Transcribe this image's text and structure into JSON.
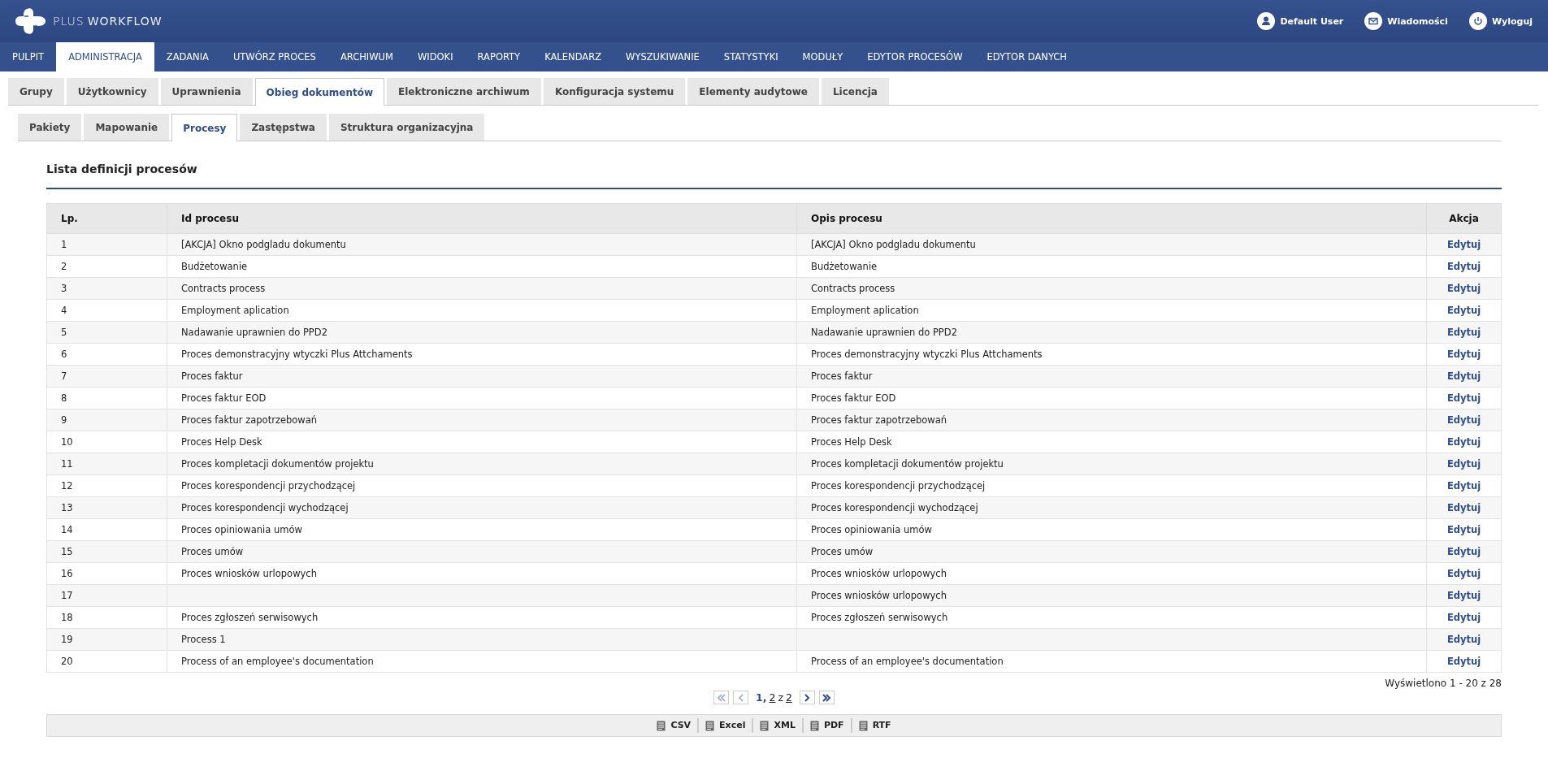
{
  "header": {
    "logo_plus": "PLUS",
    "logo_workflow": "WORKFLOW",
    "user_links": [
      {
        "kind": "user",
        "label": "Default User"
      },
      {
        "kind": "mail",
        "label": "Wiadomości"
      },
      {
        "kind": "power",
        "label": "Wyloguj"
      }
    ]
  },
  "main_menu": [
    {
      "label": "PULPIT",
      "selected": false
    },
    {
      "label": "ADMINISTRACJA",
      "selected": true
    },
    {
      "label": "ZADANIA",
      "selected": false
    },
    {
      "label": "UTWÓRZ PROCES",
      "selected": false
    },
    {
      "label": "ARCHIWUM",
      "selected": false
    },
    {
      "label": "WIDOKI",
      "selected": false
    },
    {
      "label": "RAPORTY",
      "selected": false
    },
    {
      "label": "KALENDARZ",
      "selected": false
    },
    {
      "label": "WYSZUKIWANIE",
      "selected": false
    },
    {
      "label": "STATYSTYKI",
      "selected": false
    },
    {
      "label": "MODUŁY",
      "selected": false
    },
    {
      "label": "EDYTOR PROCESÓW",
      "selected": false
    },
    {
      "label": "EDYTOR DANYCH",
      "selected": false
    }
  ],
  "tabs": [
    {
      "label": "Grupy",
      "selected": false
    },
    {
      "label": "Użytkownicy",
      "selected": false
    },
    {
      "label": "Uprawnienia",
      "selected": false
    },
    {
      "label": "Obieg dokumentów",
      "selected": true
    },
    {
      "label": "Elektroniczne archiwum",
      "selected": false
    },
    {
      "label": "Konfiguracja systemu",
      "selected": false
    },
    {
      "label": "Elementy audytowe",
      "selected": false
    },
    {
      "label": "Licencja",
      "selected": false
    }
  ],
  "subtabs": [
    {
      "label": "Pakiety",
      "selected": false
    },
    {
      "label": "Mapowanie",
      "selected": false
    },
    {
      "label": "Procesy",
      "selected": true
    },
    {
      "label": "Zastępstwa",
      "selected": false
    },
    {
      "label": "Struktura organizacyjna",
      "selected": false
    }
  ],
  "section_title": "Lista definicji procesów",
  "table": {
    "columns": [
      "Lp.",
      "Id procesu",
      "Opis procesu",
      "Akcja"
    ],
    "rows": [
      {
        "lp": "1",
        "id": "[AKCJA] Okno podgladu dokumentu",
        "opis": "[AKCJA] Okno podgladu dokumentu",
        "action": "Edytuj"
      },
      {
        "lp": "2",
        "id": "Budżetowanie",
        "opis": "Budżetowanie",
        "action": "Edytuj"
      },
      {
        "lp": "3",
        "id": "Contracts process",
        "opis": "Contracts process",
        "action": "Edytuj"
      },
      {
        "lp": "4",
        "id": "Employment aplication",
        "opis": "Employment aplication",
        "action": "Edytuj"
      },
      {
        "lp": "5",
        "id": "Nadawanie uprawnien do PPD2",
        "opis": "Nadawanie uprawnien do PPD2",
        "action": "Edytuj"
      },
      {
        "lp": "6",
        "id": "Proces demonstracyjny wtyczki Plus Attchaments",
        "opis": "Proces demonstracyjny wtyczki Plus Attchaments",
        "action": "Edytuj"
      },
      {
        "lp": "7",
        "id": "Proces faktur",
        "opis": "Proces faktur",
        "action": "Edytuj"
      },
      {
        "lp": "8",
        "id": "Proces faktur EOD",
        "opis": "Proces faktur EOD",
        "action": "Edytuj"
      },
      {
        "lp": "9",
        "id": "Proces faktur zapotrzebowań",
        "opis": "Proces faktur zapotrzebowań",
        "action": "Edytuj"
      },
      {
        "lp": "10",
        "id": "Proces Help Desk",
        "opis": "Proces Help Desk",
        "action": "Edytuj"
      },
      {
        "lp": "11",
        "id": "Proces kompletacji dokumentów projektu",
        "opis": "Proces kompletacji dokumentów projektu",
        "action": "Edytuj"
      },
      {
        "lp": "12",
        "id": "Proces korespondencji przychodzącej",
        "opis": "Proces korespondencji przychodzącej",
        "action": "Edytuj"
      },
      {
        "lp": "13",
        "id": "Proces korespondencji wychodzącej",
        "opis": "Proces korespondencji wychodzącej",
        "action": "Edytuj"
      },
      {
        "lp": "14",
        "id": "Proces opiniowania umów",
        "opis": "Proces opiniowania umów",
        "action": "Edytuj"
      },
      {
        "lp": "15",
        "id": "Proces umów",
        "opis": "Proces umów",
        "action": "Edytuj"
      },
      {
        "lp": "16",
        "id": "Proces wniosków urlopowych",
        "opis": "Proces wniosków urlopowych",
        "action": "Edytuj"
      },
      {
        "lp": "17",
        "opis": "Proces wniosków urlopowych",
        "action": "Edytuj"
      },
      {
        "lp": "18",
        "id": "Proces zgłoszeń serwisowych",
        "opis": "Proces zgłoszeń serwisowych",
        "action": "Edytuj"
      },
      {
        "lp": "19",
        "id": "Process 1",
        "action": "Edytuj"
      },
      {
        "lp": "20",
        "id": "Process of an employee's documentation",
        "opis": "Process of an employee's documentation",
        "action": "Edytuj"
      }
    ]
  },
  "shown_info": "Wyświetlono 1 - 20 z 28",
  "pagination": {
    "nav": [
      {
        "kind": "first",
        "disabled": true
      },
      {
        "kind": "prev",
        "disabled": true
      },
      {
        "kind": "next",
        "disabled": false
      },
      {
        "kind": "last",
        "disabled": false
      }
    ],
    "pages": [
      {
        "label": "1",
        "selected": true
      },
      {
        "label": "2",
        "selected": false
      }
    ],
    "separator": ",",
    "of_label": "z",
    "total": "2"
  },
  "exports": [
    {
      "label": "CSV"
    },
    {
      "label": "Excel"
    },
    {
      "label": "XML"
    },
    {
      "label": "PDF"
    },
    {
      "label": "RTF"
    }
  ]
}
